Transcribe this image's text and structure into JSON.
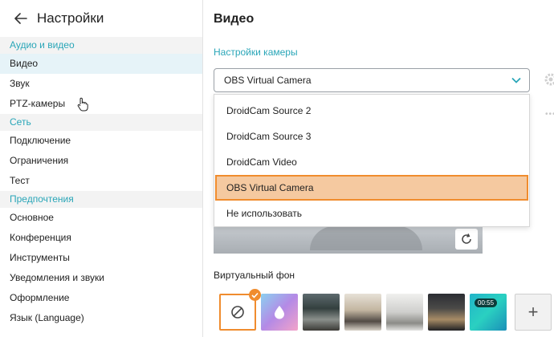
{
  "sidebar": {
    "title": "Настройки",
    "sections": [
      {
        "label": "Аудио и видео",
        "items": [
          "Видео",
          "Звук",
          "PTZ-камеры"
        ]
      },
      {
        "label": "Сеть",
        "items": [
          "Подключение",
          "Ограничения",
          "Тест"
        ]
      },
      {
        "label": "Предпочтения",
        "items": [
          "Основное",
          "Конференция",
          "Инструменты",
          "Уведомления и звуки",
          "Оформление",
          "Язык (Language)"
        ]
      }
    ],
    "active_item": "Видео"
  },
  "main": {
    "title": "Видео",
    "camera_settings_label": "Настройки камеры",
    "camera_select_value": "OBS Virtual Camera",
    "dropdown_options": [
      "DroidCam Source 2",
      "DroidCam Source 3",
      "DroidCam Video",
      "OBS Virtual Camera",
      "Не использовать"
    ],
    "selected_option": "OBS Virtual Camera",
    "virtual_bg_label": "Виртуальный фон",
    "virtual_bg_video_duration": "00:55"
  },
  "colors": {
    "accent": "#2aa6b8",
    "highlight": "#f08c2e",
    "selected_bg": "#f5c9a0"
  }
}
